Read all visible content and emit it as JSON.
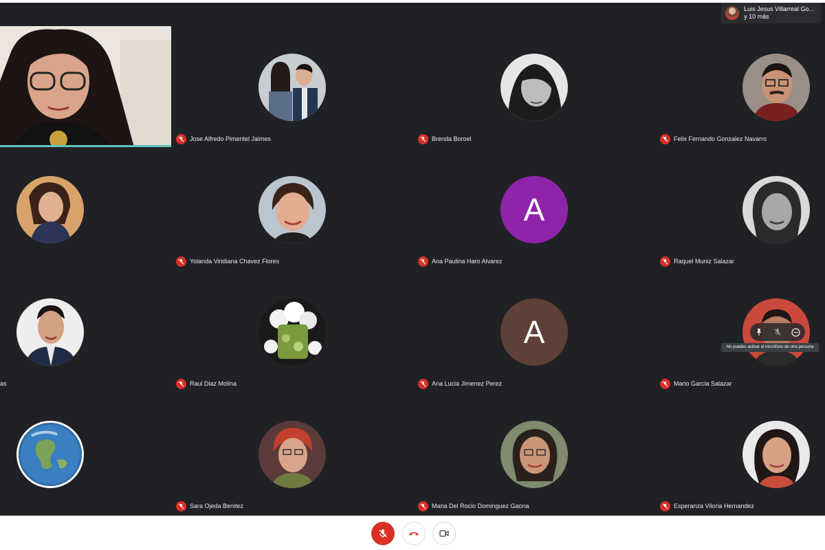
{
  "topbar": {
    "presenter_name": "Luis Jesus Villarreal Go...",
    "presenter_more": "y 10 más"
  },
  "grid": {
    "row1": [
      {
        "name": "Jose Alfredo Pimentel Jaimes",
        "avatar": "photo-couple"
      },
      {
        "name": "Brenda Boroel",
        "avatar": "photo-woman-bw"
      },
      {
        "name": "Felix Fernando Gonzalez Navarro",
        "avatar": "photo-man-glasses"
      }
    ],
    "row2": [
      {
        "name": "",
        "avatar": "photo-woman-selfie"
      },
      {
        "name": "Yolanda Viridiana Chavez Flores",
        "avatar": "photo-woman-smiling"
      },
      {
        "name": "Ana Paulina Haro Alvarez",
        "avatar": "letter",
        "letter": "A",
        "color": "#8e24aa"
      },
      {
        "name": "Raquel Muniz Salazar",
        "avatar": "photo-woman-bw"
      }
    ],
    "row3": [
      {
        "name": "as",
        "avatar": "photo-man-suit"
      },
      {
        "name": "Raul Diaz Molina",
        "avatar": "photo-drink"
      },
      {
        "name": "Ana Lucia Jimenez Perez",
        "avatar": "letter",
        "letter": "A",
        "color": "#5d4037"
      },
      {
        "name": "Mario Garcia Salazar",
        "avatar": "photo-man"
      }
    ],
    "row4": [
      {
        "name": "",
        "avatar": "photo-earth"
      },
      {
        "name": "Sara Ojeda Benitez",
        "avatar": "photo-woman-red-hair"
      },
      {
        "name": "Maria Del Rocio Dominguez Gaona",
        "avatar": "photo-woman-glasses"
      },
      {
        "name": "Esperanza Viloria Hernandez",
        "avatar": "photo-woman-smiling"
      }
    ]
  },
  "hover": {
    "tooltip": "No puedes activar el micrófono de otra persona",
    "icons": [
      "pin-icon",
      "mic-off-icon",
      "remove-icon"
    ]
  },
  "controls": {
    "mic": "mic-off-icon",
    "hangup": "hangup-icon",
    "camera": "camera-icon"
  },
  "colors": {
    "stage": "#202124",
    "mic_muted": "#d93025",
    "self_border": "#5fc5c0"
  }
}
